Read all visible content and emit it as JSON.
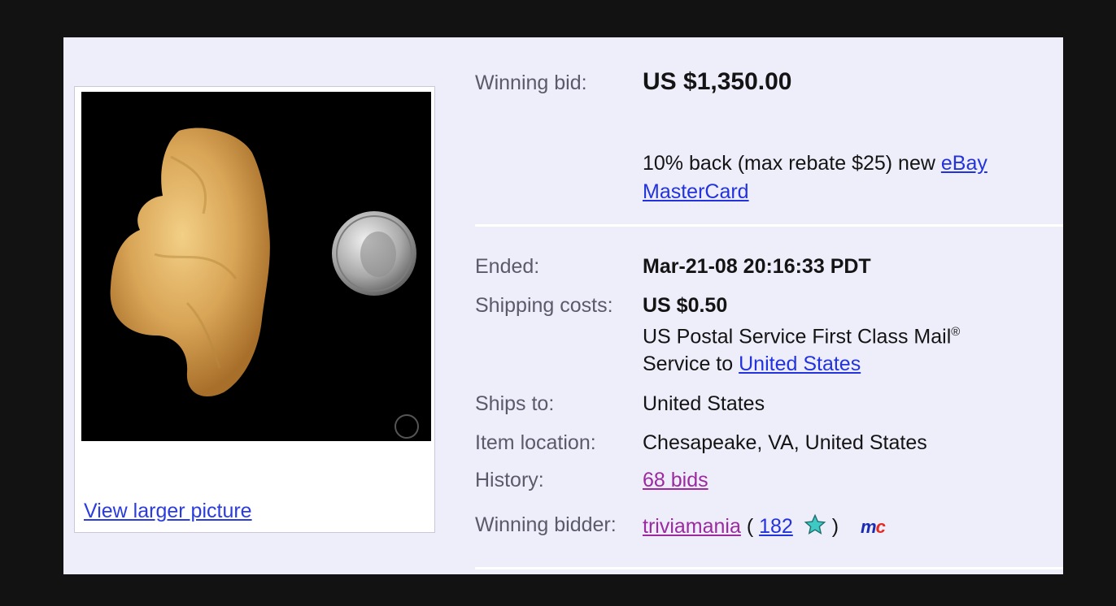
{
  "image": {
    "view_larger_label": "View larger picture"
  },
  "winning_bid": {
    "label": "Winning bid:",
    "value": "US $1,350.00"
  },
  "promo": {
    "text": "10% back (max rebate $25) new ",
    "link": "eBay MasterCard"
  },
  "ended": {
    "label": "Ended:",
    "value": "Mar-21-08 20:16:33 PDT"
  },
  "shipping": {
    "label": "Shipping costs:",
    "value": "US $0.50",
    "service": "US Postal Service First Class Mail",
    "service_mark": "®",
    "service_to": "Service to ",
    "service_to_link": "United States"
  },
  "ships_to": {
    "label": "Ships to:",
    "value": "United States"
  },
  "item_location": {
    "label": "Item location:",
    "value": "Chesapeake, VA, United States"
  },
  "history": {
    "label": "History:",
    "value": "68 bids"
  },
  "winning_bidder": {
    "label": "Winning bidder:",
    "user": "triviamania",
    "open_paren": " ( ",
    "feedback": "182",
    "close_paren": " )",
    "star_icon": "turquoise-star-icon",
    "logo_m": "m",
    "logo_c": "c"
  },
  "colors": {
    "background": "#121212",
    "panel": "#eeeefb",
    "link": "#2233dd",
    "visited_link": "#9b2aa0"
  }
}
